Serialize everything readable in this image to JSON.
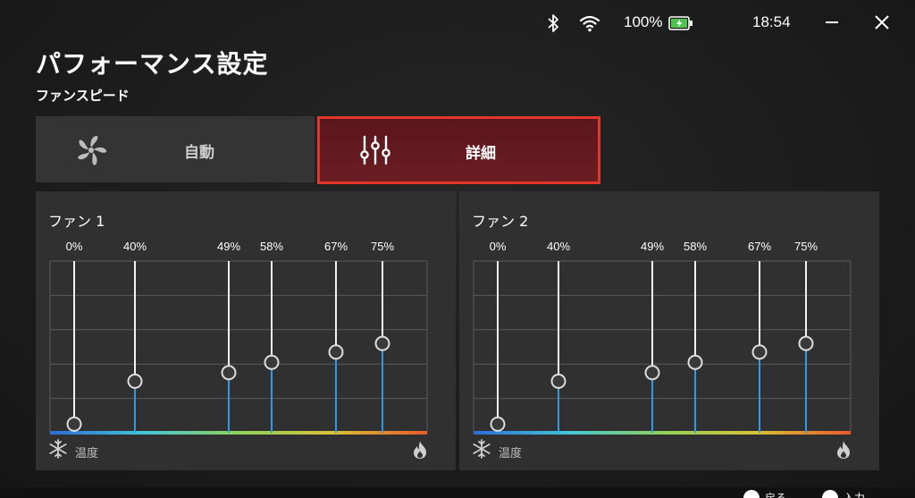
{
  "status": {
    "battery_percent": "100%",
    "time": "18:54",
    "icons": [
      "bluetooth-icon",
      "wifi-icon",
      "battery-charging-icon",
      "minimize-icon",
      "close-icon"
    ]
  },
  "title": "パフォーマンス設定",
  "subtitle": "ファンスピード",
  "tabs": [
    {
      "label": "自動",
      "icon": "fan-icon",
      "selected": false
    },
    {
      "label": "詳細",
      "icon": "sliders-icon",
      "selected": true
    }
  ],
  "colors": {
    "accent": "#e2362a",
    "selected_tab_bg": "#5f1a1f",
    "slider_active": "#2e9be8",
    "gradient": [
      "#2b6cd6",
      "#45c6d9",
      "#8fd35a",
      "#d9c238",
      "#e85b2a"
    ]
  },
  "fans": [
    {
      "title": "ファン 1",
      "temperature_label": "温度",
      "points": [
        {
          "label": "0%",
          "level": 0.05
        },
        {
          "label": "40%",
          "level": 0.3
        },
        {
          "label": "49%",
          "level": 0.35
        },
        {
          "label": "58%",
          "level": 0.41
        },
        {
          "label": "67%",
          "level": 0.47
        },
        {
          "label": "75%",
          "level": 0.52
        }
      ]
    },
    {
      "title": "ファン 2",
      "temperature_label": "温度",
      "points": [
        {
          "label": "0%",
          "level": 0.05
        },
        {
          "label": "40%",
          "level": 0.3
        },
        {
          "label": "49%",
          "level": 0.35
        },
        {
          "label": "58%",
          "level": 0.41
        },
        {
          "label": "67%",
          "level": 0.47
        },
        {
          "label": "75%",
          "level": 0.52
        }
      ]
    }
  ],
  "footer_hints": [
    {
      "button": "B",
      "label": "戻る"
    },
    {
      "button": "A",
      "label": "入力"
    }
  ]
}
